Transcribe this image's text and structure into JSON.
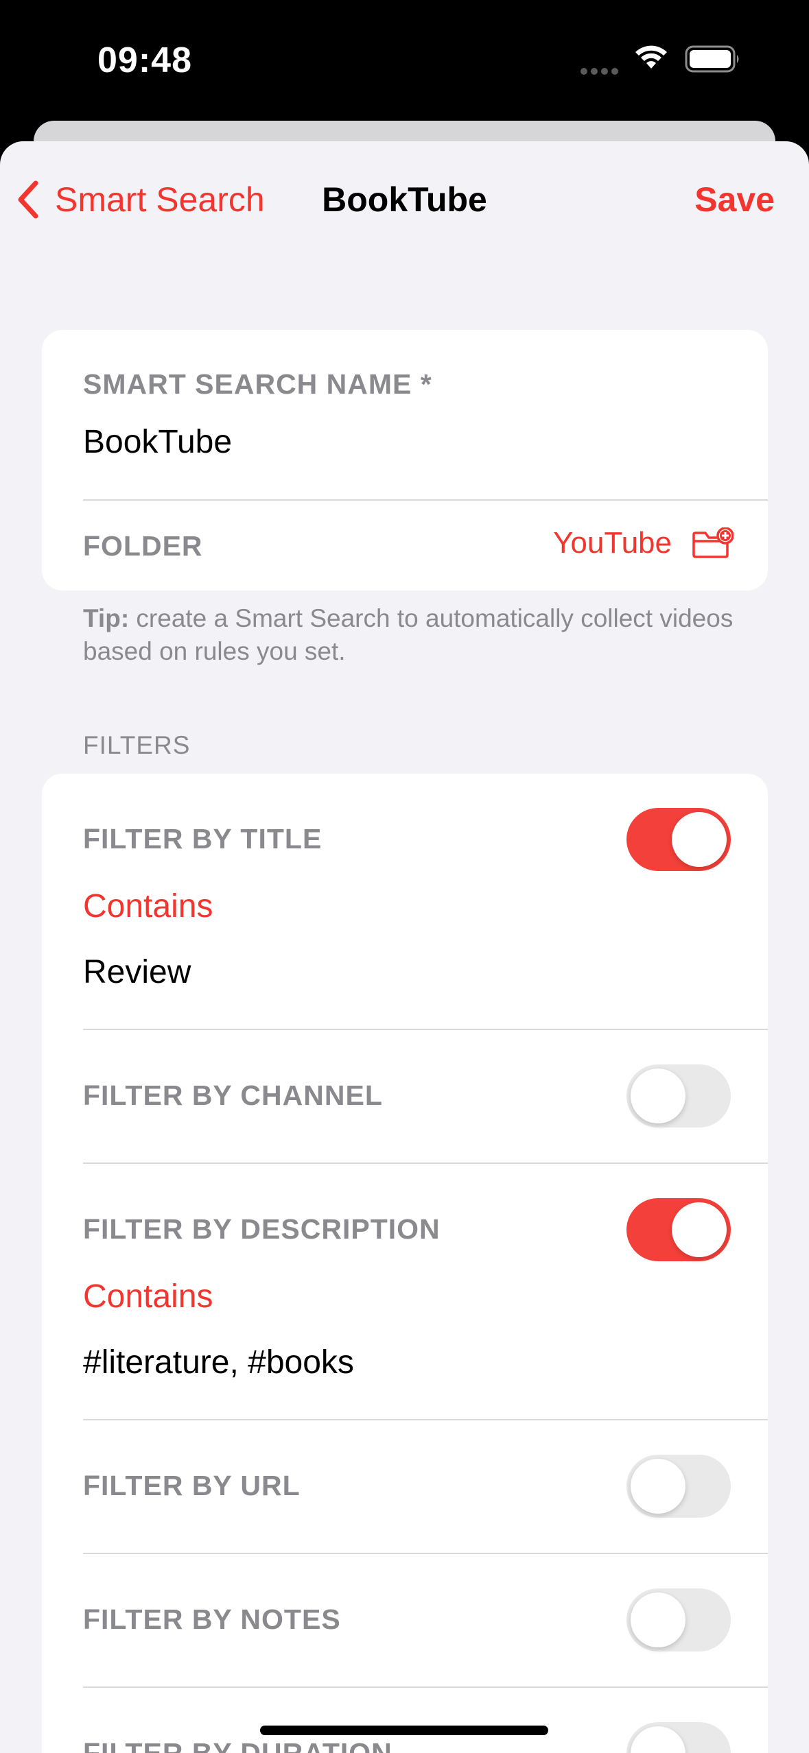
{
  "status_bar": {
    "time": "09:48",
    "icons": [
      "cellular-dots-icon",
      "wifi-icon",
      "battery-icon"
    ]
  },
  "nav": {
    "back_label": "Smart Search",
    "title": "BookTube",
    "save_label": "Save"
  },
  "name_section": {
    "name_label": "SMART SEARCH NAME *",
    "name_value": "BookTube",
    "folder_label": "FOLDER",
    "folder_value": "YouTube"
  },
  "tip": {
    "bold": "Tip:",
    "text": " create a Smart Search to automatically collect videos based on rules you set."
  },
  "filters": {
    "section_title": "FILTERS",
    "items": [
      {
        "label": "FILTER BY TITLE",
        "enabled": true,
        "match": "Contains",
        "value": "Review"
      },
      {
        "label": "FILTER BY CHANNEL",
        "enabled": false
      },
      {
        "label": "FILTER BY DESCRIPTION",
        "enabled": true,
        "match": "Contains",
        "value": "#literature, #books"
      },
      {
        "label": "FILTER BY URL",
        "enabled": false
      },
      {
        "label": "FILTER BY NOTES",
        "enabled": false
      },
      {
        "label": "FILTER BY DURATION",
        "enabled": false
      }
    ]
  },
  "colors": {
    "accent": "#f2362f",
    "toggle_on": "#f4403a",
    "toggle_off": "#e9e9ea",
    "background": "#f2f2f7",
    "secondary_text": "#8a8a8e"
  }
}
